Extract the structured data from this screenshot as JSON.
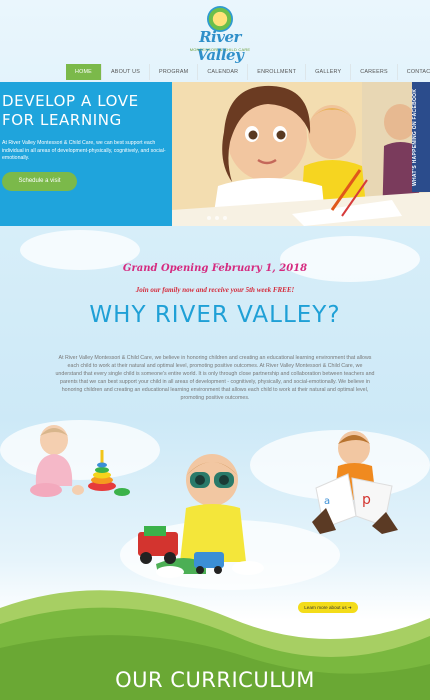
{
  "logo": {
    "name": "River Valley",
    "subtitle": "MONTESSORI & CHILD CARE"
  },
  "nav": {
    "items": [
      {
        "label": "HOME",
        "active": true
      },
      {
        "label": "ABOUT US",
        "active": false
      },
      {
        "label": "PROGRAM",
        "active": false
      },
      {
        "label": "CALENDAR",
        "active": false
      },
      {
        "label": "ENROLLMENT",
        "active": false
      },
      {
        "label": "GALLERY",
        "active": false
      },
      {
        "label": "CAREERS",
        "active": false
      },
      {
        "label": "CONTACT US",
        "active": false
      }
    ]
  },
  "hero": {
    "title": "DEVELOP A LOVE FOR LEARNING",
    "text": "At River Valley Montessori & Child Care, we can best support each individual in all areas of development-physically, cognitively, and social-emotionally.",
    "button": "Schedule a visit",
    "facebook_tab": "WHAT'S HAPPENING ON FACEBOOK"
  },
  "announcement": {
    "headline": "Grand Opening February 1, 2018",
    "promo": "Join our family now and receive your 5th week FREE!"
  },
  "why": {
    "title": "WHY RIVER VALLEY?",
    "paragraph": "At River Valley Montessori & Child Care, we believe in honoring children and creating an educational learning environment that allows each child to work at their natural and optimal level, promoting positive outcomes. At River Valley Montessori & Child Care, we understand that every single child is someone's entire world.  It is only through close partnership and collaboration between teachers and parents that we can best support your child in all areas of development - cognitively, physically, and social-emotionally.  We believe in honoring children and creating an educational learning environment that allows each child to work at their natural and optimal level, promoting positive outcomes.",
    "learn_more": "Learn more about us"
  },
  "curriculum": {
    "title": "OUR CURRICULUM"
  },
  "colors": {
    "accent_blue": "#1fa4dc",
    "accent_green": "#7bb94a",
    "pink": "#d52a7f",
    "facebook_blue": "#2b4c8c",
    "yellow": "#f3dc1a"
  }
}
